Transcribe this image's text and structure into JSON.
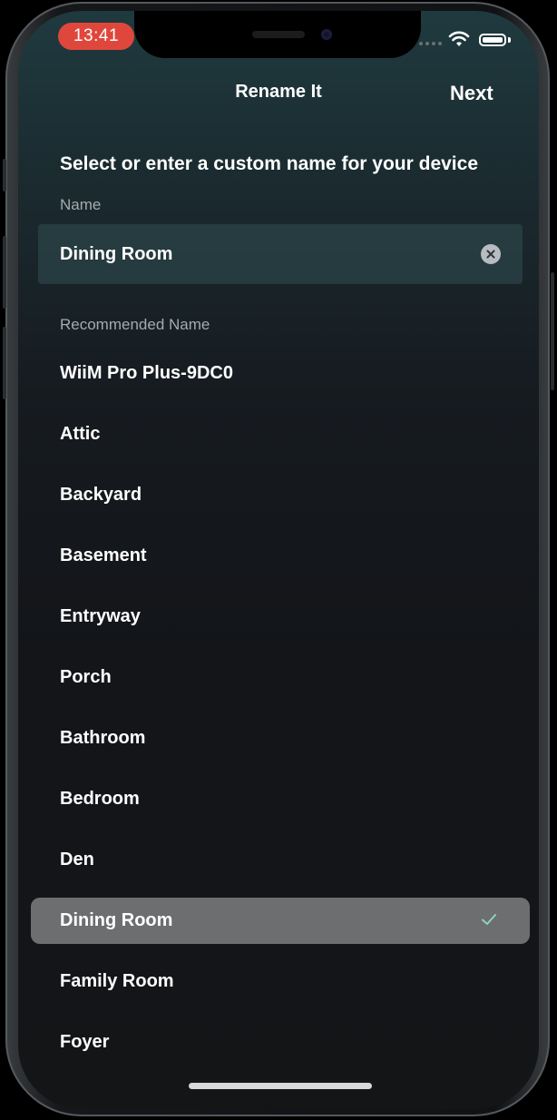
{
  "status_bar": {
    "time": "13:41"
  },
  "nav": {
    "title": "Rename It",
    "next_label": "Next"
  },
  "instructions": "Select or enter a custom name for your device",
  "name_field": {
    "label": "Name",
    "value": "Dining Room"
  },
  "recommended": {
    "label": "Recommended Name",
    "items": [
      {
        "label": "WiiM Pro Plus-9DC0",
        "selected": false
      },
      {
        "label": "Attic",
        "selected": false
      },
      {
        "label": "Backyard",
        "selected": false
      },
      {
        "label": "Basement",
        "selected": false
      },
      {
        "label": "Entryway",
        "selected": false
      },
      {
        "label": "Porch",
        "selected": false
      },
      {
        "label": "Bathroom",
        "selected": false
      },
      {
        "label": "Bedroom",
        "selected": false
      },
      {
        "label": "Den",
        "selected": false
      },
      {
        "label": "Dining Room",
        "selected": true
      },
      {
        "label": "Family Room",
        "selected": false
      },
      {
        "label": "Foyer",
        "selected": false
      }
    ]
  },
  "colors": {
    "accent_check": "#8fd3b8",
    "selected_row": "#6d6e70",
    "time_pill": "#e0473c"
  }
}
